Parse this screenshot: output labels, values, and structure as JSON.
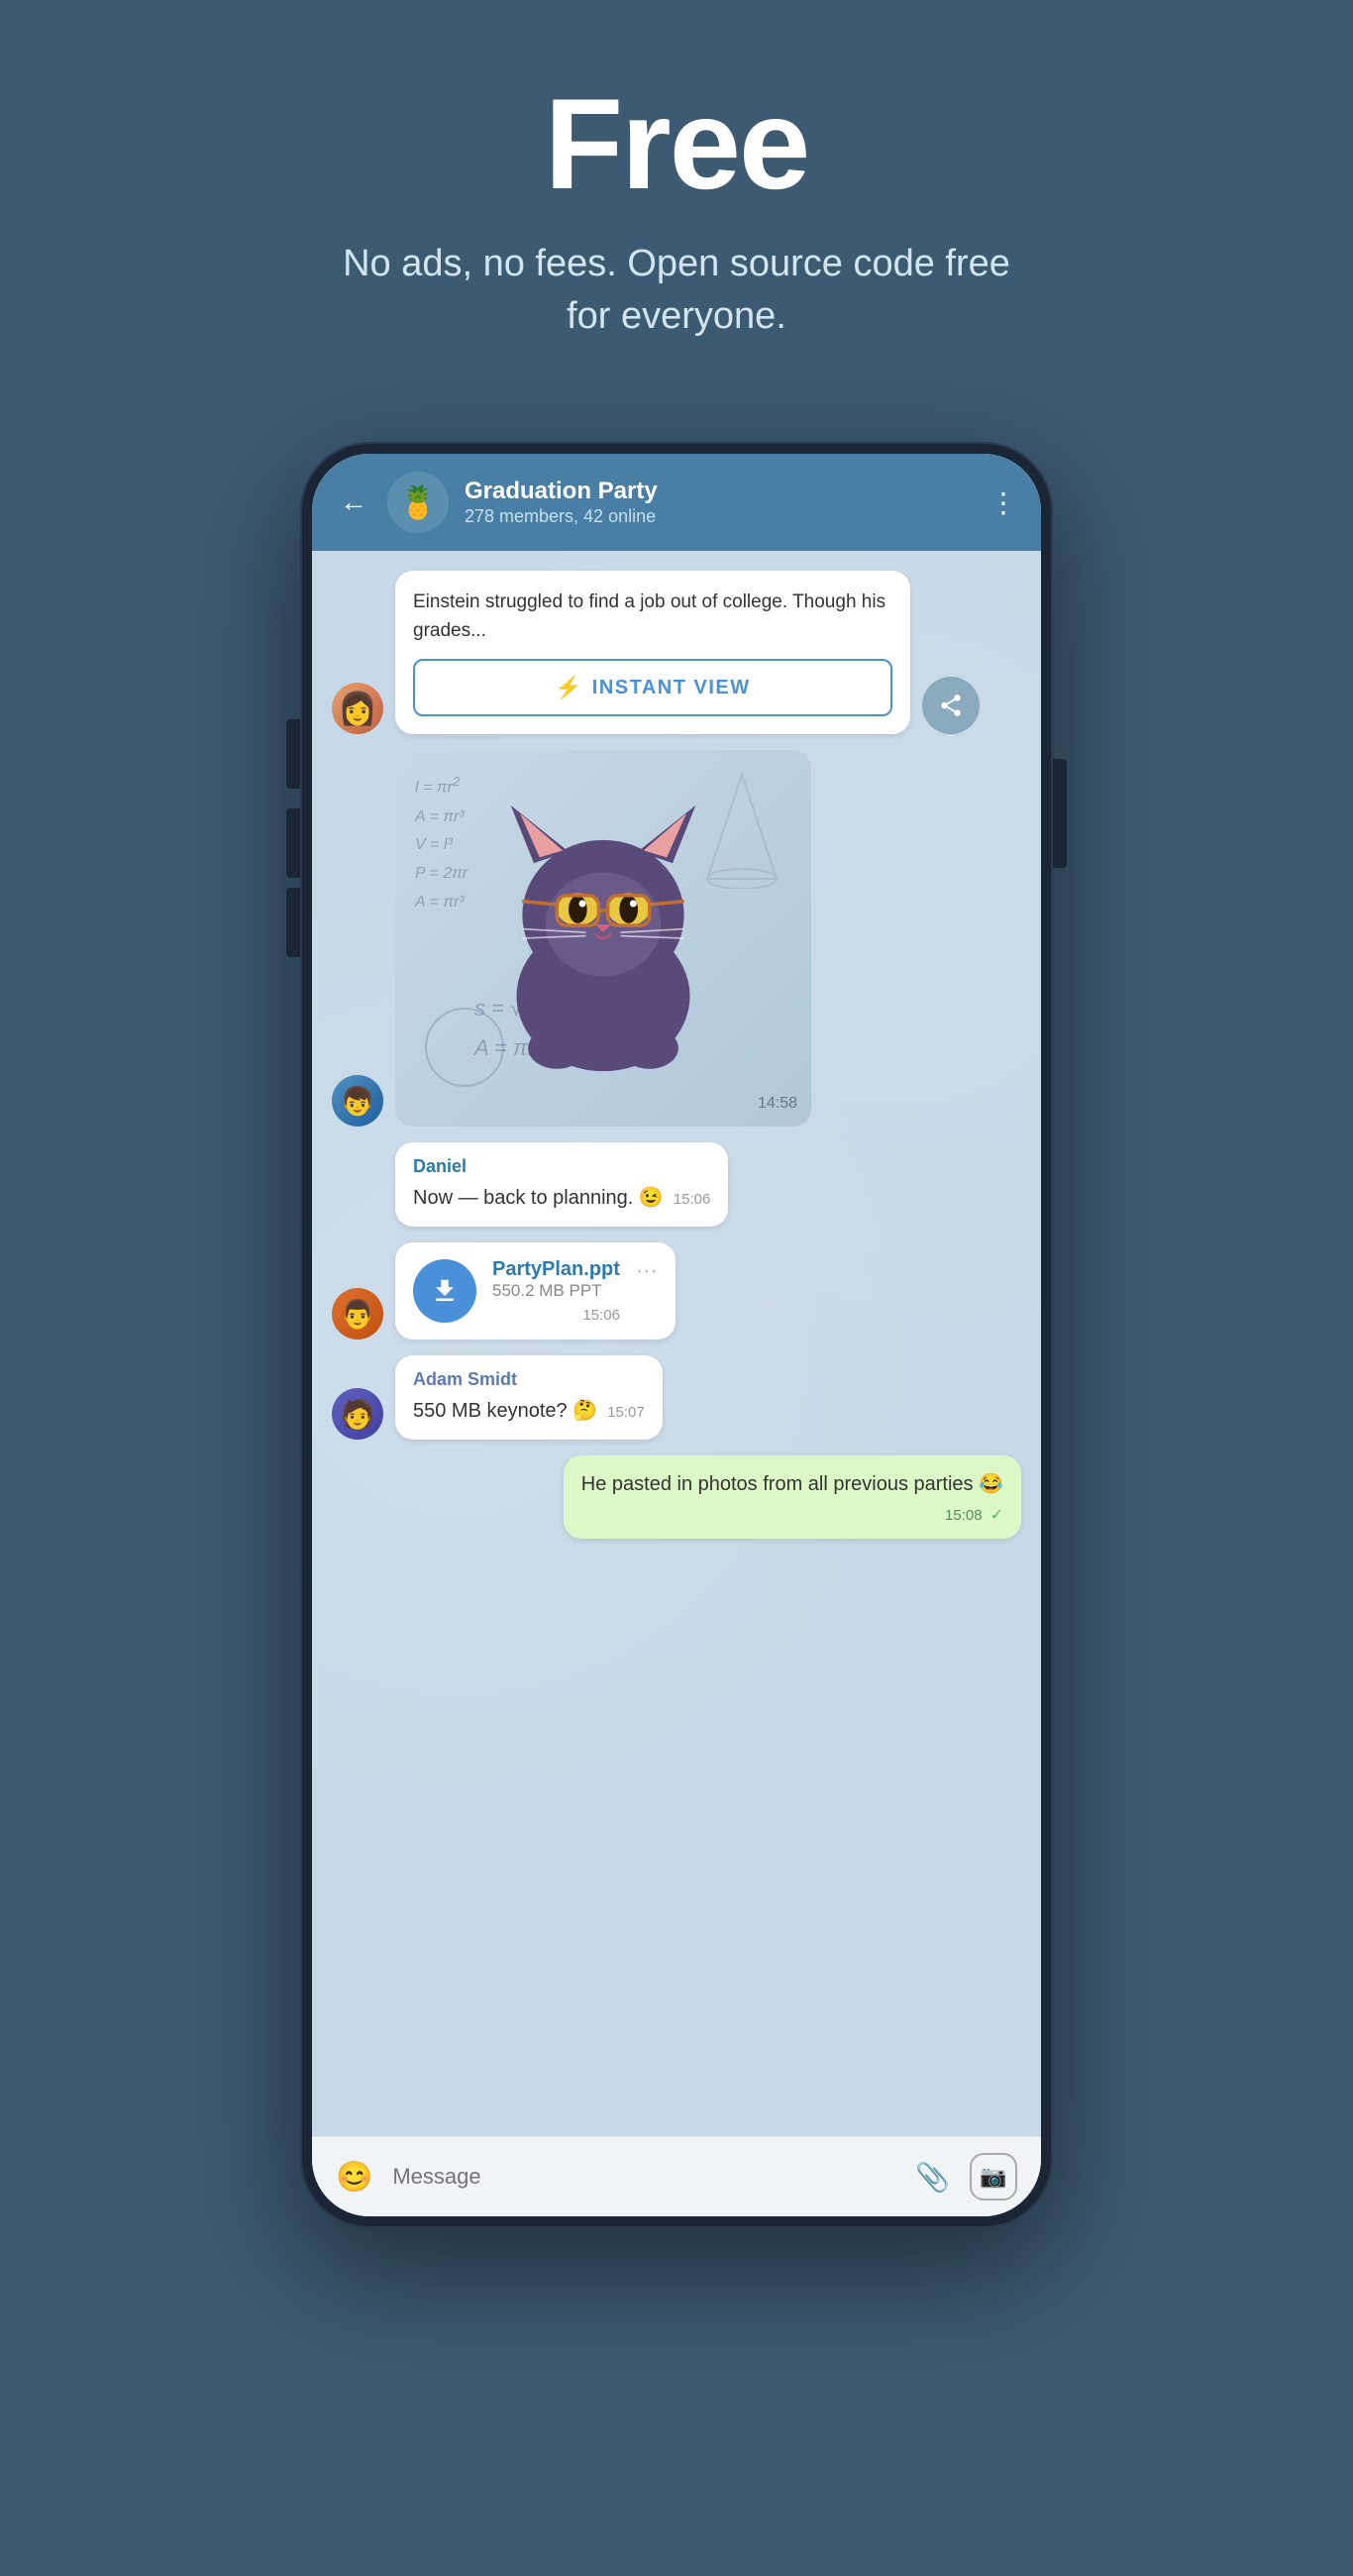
{
  "hero": {
    "title": "Free",
    "subtitle": "No ads, no fees. Open source code free for everyone."
  },
  "chat": {
    "group_name": "Graduation Party",
    "group_status": "278 members, 42 online",
    "back_label": "←",
    "menu_label": "⋮",
    "avatar_emoji": "🍍",
    "messages": [
      {
        "id": "article-msg",
        "type": "article",
        "text": "Einstein struggled to find a job out of college. Though his grades...",
        "instant_view_label": "INSTANT VIEW",
        "sender": "female",
        "share_button": true
      },
      {
        "id": "sticker-msg",
        "type": "sticker",
        "time": "14:58",
        "sender": "male1"
      },
      {
        "id": "daniel-msg",
        "type": "text",
        "sender_name": "Daniel",
        "text": "Now — back to planning. 😉",
        "time": "15:06",
        "sender": "none",
        "bubble_type": "white"
      },
      {
        "id": "file-msg",
        "type": "file",
        "file_name": "PartyPlan.ppt",
        "file_size": "550.2 MB PPT",
        "time": "15:06",
        "sender": "male2",
        "bubble_type": "white"
      },
      {
        "id": "adam-msg",
        "type": "text",
        "sender_name": "Adam Smidt",
        "text": "550 MB keynote? 🤔",
        "time": "15:07",
        "sender": "male3",
        "bubble_type": "white"
      },
      {
        "id": "my-msg",
        "type": "text",
        "sender_name": null,
        "text": "He pasted in photos from all previous parties 😂",
        "time": "15:08",
        "sender": "self",
        "bubble_type": "green"
      }
    ],
    "input": {
      "placeholder": "Message",
      "emoji_icon": "😊",
      "attach_icon": "📎",
      "camera_icon": "📷"
    }
  }
}
